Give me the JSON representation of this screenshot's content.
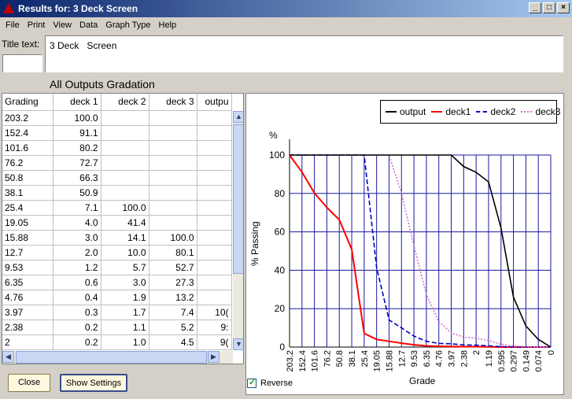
{
  "window": {
    "title": "Results for: 3 Deck  Screen"
  },
  "menu": [
    "File",
    "Print",
    "View",
    "Data",
    "Graph Type",
    "Help"
  ],
  "title_text": {
    "label": "Title text:",
    "value": "3 Deck   Screen"
  },
  "gradation_title": "All Outputs Gradation",
  "table": {
    "headers": [
      "Grading",
      "deck 1",
      "deck 2",
      "deck 3",
      "outpu"
    ],
    "rows": [
      [
        "203.2",
        "100.0",
        "",
        "",
        ""
      ],
      [
        "152.4",
        "91.1",
        "",
        "",
        ""
      ],
      [
        "101.6",
        "80.2",
        "",
        "",
        ""
      ],
      [
        "76.2",
        "72.7",
        "",
        "",
        ""
      ],
      [
        "50.8",
        "66.3",
        "",
        "",
        ""
      ],
      [
        "38.1",
        "50.9",
        "",
        "",
        ""
      ],
      [
        "25.4",
        "7.1",
        "100.0",
        "",
        ""
      ],
      [
        "19.05",
        "4.0",
        "41.4",
        "",
        ""
      ],
      [
        "15.88",
        "3.0",
        "14.1",
        "100.0",
        ""
      ],
      [
        "12.7",
        "2.0",
        "10.0",
        "80.1",
        ""
      ],
      [
        "9.53",
        "1.2",
        "5.7",
        "52.7",
        ""
      ],
      [
        "6.35",
        "0.6",
        "3.0",
        "27.3",
        ""
      ],
      [
        "4.76",
        "0.4",
        "1.9",
        "13.2",
        ""
      ],
      [
        "3.97",
        "0.3",
        "1.7",
        "7.4",
        "10("
      ],
      [
        "2.38",
        "0.2",
        "1.1",
        "5.2",
        "9:"
      ],
      [
        "2",
        "0.2",
        "1.0",
        "4.5",
        "9("
      ]
    ]
  },
  "buttons": {
    "close": "Close",
    "settings": "Show Settings"
  },
  "reverse_label": "Reverse",
  "chart_data": {
    "type": "line",
    "ylabel_unit": "%",
    "ylabel": "% Passing",
    "xlabel": "Grade",
    "ylim": [
      0,
      100
    ],
    "yticks": [
      "0",
      "20",
      "40",
      "60",
      "80",
      "100"
    ],
    "categories": [
      "203.2",
      "152.4",
      "101.6",
      "76.2",
      "50.8",
      "38.1",
      "25.4",
      "19.05",
      "15.88",
      "12.7",
      "9.53",
      "6.35",
      "4.76",
      "3.97",
      "2.38",
      "2",
      "1.19",
      "0.595",
      "0.297",
      "0.149",
      "0.074",
      "0"
    ],
    "grid": true,
    "legend_position": "top-right",
    "series": [
      {
        "name": "output",
        "color": "#000000",
        "dash": "solid",
        "values": [
          100,
          100,
          100,
          100,
          100,
          100,
          100,
          100,
          100,
          100,
          100,
          100,
          100,
          100,
          94,
          91,
          86,
          62,
          26,
          11,
          4,
          0
        ]
      },
      {
        "name": "deck1",
        "color": "#ff0000",
        "dash": "solid",
        "values": [
          100,
          91.1,
          80.2,
          72.7,
          66.3,
          50.9,
          7.1,
          4.0,
          3.0,
          2.0,
          1.2,
          0.6,
          0.4,
          0.3,
          0.2,
          0.2,
          0.1,
          0,
          0,
          0,
          0,
          0
        ]
      },
      {
        "name": "deck2",
        "color": "#0000c0",
        "dash": "dashed",
        "values": [
          100,
          100,
          100,
          100,
          100,
          100,
          100,
          41.4,
          14.1,
          10.0,
          5.7,
          3.0,
          1.9,
          1.7,
          1.1,
          1.0,
          0.6,
          0.2,
          0,
          0,
          0,
          0
        ]
      },
      {
        "name": "deck3",
        "color": "#d070d0",
        "dash": "dotted",
        "values": [
          100,
          100,
          100,
          100,
          100,
          100,
          100,
          100,
          100,
          80.1,
          52.7,
          27.3,
          13.2,
          7.4,
          5.2,
          4.5,
          3.5,
          1.5,
          0.5,
          0.2,
          0,
          0
        ]
      }
    ]
  }
}
